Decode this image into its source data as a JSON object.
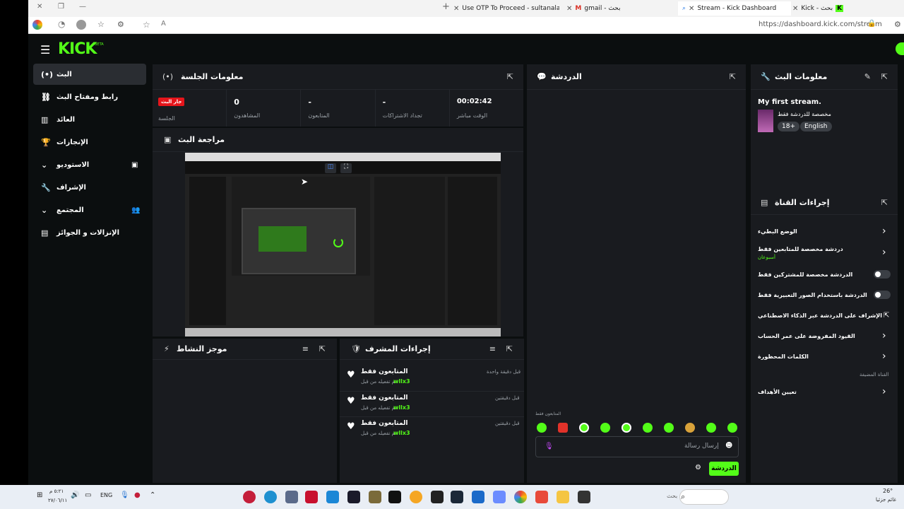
{
  "browser": {
    "tabs": [
      {
        "title": "Use OTP To Proceed - sultanalasi",
        "icon": "document-icon"
      },
      {
        "title": "gmail - بحث",
        "icon": "gmail-icon"
      },
      {
        "title": "Stream - Kick Dashboard",
        "icon": "search-icon"
      },
      {
        "title": "Kick - بحث",
        "icon": "kick-icon"
      }
    ],
    "url": "https://dashboard.kick.com/stream",
    "read_aloud": "A"
  },
  "brand": {
    "logo": "KICK",
    "beta": "BETA",
    "accent": "#53fc18"
  },
  "sidebar": {
    "items": [
      {
        "label": "البث",
        "icon": "broadcast-icon"
      },
      {
        "label": "رابط ومفتاح البث",
        "icon": "link-icon"
      },
      {
        "label": "العائد",
        "icon": "chart-icon"
      },
      {
        "label": "الإنجازات",
        "icon": "trophy-icon"
      },
      {
        "label": "الاستوديو",
        "icon": "studio-icon"
      },
      {
        "label": "الإشراف",
        "icon": "wrench-icon"
      },
      {
        "label": "المجتمع",
        "icon": "community-icon"
      },
      {
        "label": "الإنزالات و الجوائز",
        "icon": "drops-icon"
      }
    ]
  },
  "session": {
    "title": "معلومات الجلسة",
    "live_badge": "جار البث",
    "stats": [
      {
        "value": "",
        "label": "الجلسة"
      },
      {
        "value": "0",
        "label": "المشاهدون"
      },
      {
        "value": "-",
        "label": "المتابعون"
      },
      {
        "value": "-",
        "label": "تجداد الاشتراكات"
      },
      {
        "value": "00:02:42",
        "label": "الوقت مباشر"
      }
    ]
  },
  "preview": {
    "title": "مراجعة البث"
  },
  "activity": {
    "title": "موجز النشاط"
  },
  "mod_actions": {
    "title": "إجراءات المشرف",
    "items": [
      {
        "title": "المتابعون فقط",
        "desc": "تم تفعيله من قبل",
        "user": "wllx3",
        "time": "قبل دقيقة واحدة"
      },
      {
        "title": "المتابعون فقط",
        "desc": "تم تفعيله من قبل",
        "user": "wllx3",
        "time": "قبل دقيقتين"
      },
      {
        "title": "المتابعون فقط",
        "desc": "تم تفعيله من قبل",
        "user": "wllx3",
        "time": "قبل دقيقتين"
      }
    ]
  },
  "chat": {
    "title": "الدردشة",
    "followers_only": "المتابعون فقط",
    "placeholder": "إرسال رسالة",
    "send_label": "الدردشة"
  },
  "stream_info": {
    "title": "معلومات البث",
    "stream_title": "My first stream.",
    "category": "مخصصة للدردشة فقط",
    "tags": [
      "18+",
      "English"
    ]
  },
  "channel_actions": {
    "title": "إجراءات القناة",
    "items": [
      {
        "label": "الوضع البطيء",
        "sub": "",
        "control": "chevron"
      },
      {
        "label": "دردشة مخصصة للمتابعين فقط",
        "sub": "أسبوعان",
        "control": "chevron"
      },
      {
        "label": "الدردشة مخصصة للمشتركين فقط",
        "sub": "",
        "control": "toggle"
      },
      {
        "label": "الدردشة باستخدام الصور التعبيرية فقط",
        "sub": "",
        "control": "toggle"
      },
      {
        "label": "الإشراف على الدردشة عبر الذكاء الاصطناعي",
        "sub": "",
        "control": "external"
      },
      {
        "label": "القيود المفروضة على عمر الحساب",
        "sub": "",
        "control": "chevron"
      },
      {
        "label": "الكلمات المحظورة",
        "sub": "",
        "control": "chevron"
      }
    ],
    "section_label": "القناة المضيفة",
    "target_label": "تعيين الأهداف"
  },
  "taskbar": {
    "search_placeholder": "بحث",
    "lang": "ENG",
    "time": "٥:٢١ م",
    "date": "٢٧/٠٦/١١",
    "weather": "26°",
    "weather_desc": "غائم جزئيا"
  }
}
